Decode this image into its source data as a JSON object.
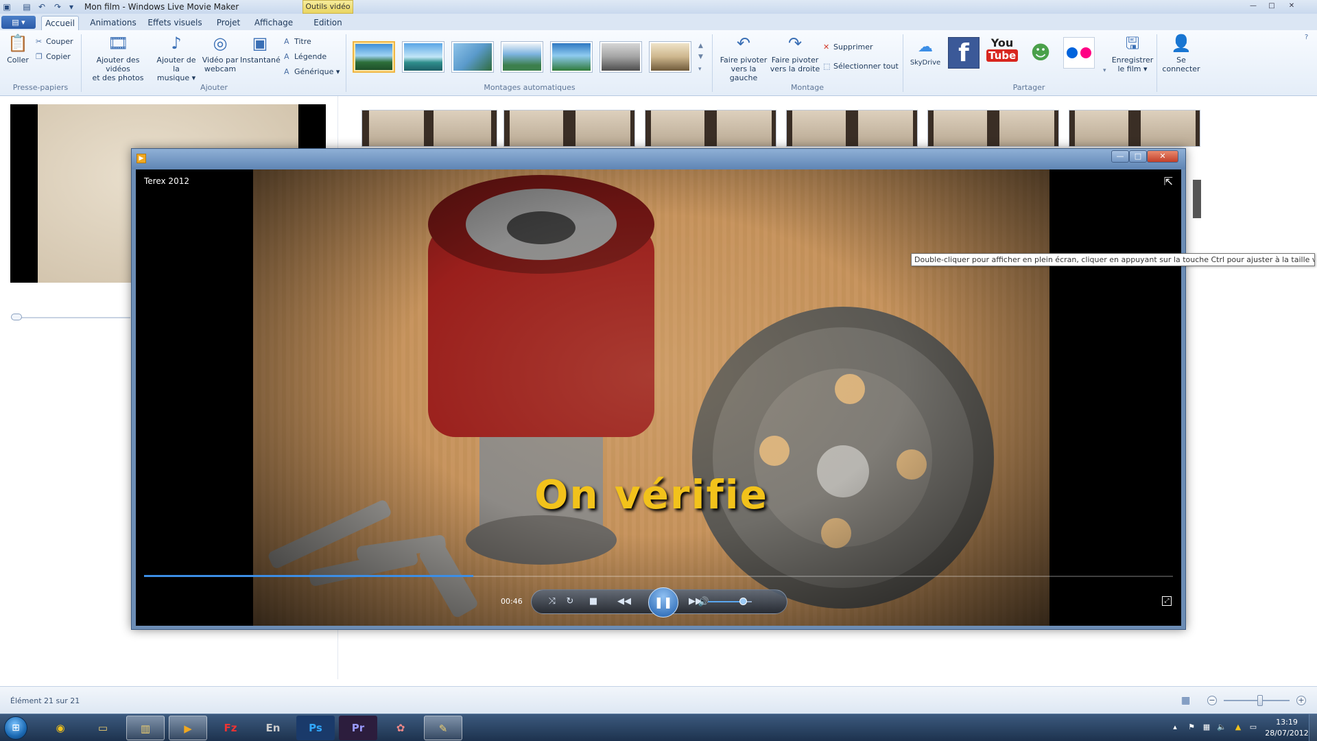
{
  "window": {
    "title": "Mon film - Windows Live Movie Maker",
    "contextual_tab": "Outils vidéo",
    "controls": {
      "minimize": "—",
      "maximize": "□",
      "close": "✕"
    }
  },
  "ribbon": {
    "file_button": "▤ ▾",
    "tabs": [
      {
        "label": "Accueil",
        "active": true
      },
      {
        "label": "Animations"
      },
      {
        "label": "Effets visuels"
      },
      {
        "label": "Projet"
      },
      {
        "label": "Affichage"
      },
      {
        "label": "Edition"
      }
    ],
    "groups": {
      "clipboard": {
        "label": "Presse-papiers",
        "paste": "Coller",
        "cut": "Couper",
        "copy": "Copier"
      },
      "add": {
        "label": "Ajouter",
        "add_videos_line1": "Ajouter des vidéos",
        "add_videos_line2": "et des photos",
        "add_music_line1": "Ajouter de la",
        "add_music_line2": "musique ▾",
        "webcam_line1": "Vidéo par",
        "webcam_line2": "webcam",
        "snapshot": "Instantané",
        "title": "Titre",
        "caption": "Légende",
        "credits": "Générique ▾"
      },
      "auto_movie": {
        "label": "Montages automatiques"
      },
      "editing": {
        "label": "Montage",
        "rotate_left_line1": "Faire pivoter",
        "rotate_left_line2": "vers la gauche",
        "rotate_right_line1": "Faire pivoter",
        "rotate_right_line2": "vers la droite",
        "delete": "Supprimer",
        "select_all": "Sélectionner tout"
      },
      "share": {
        "label": "Partager",
        "skydrive": "SkyDrive",
        "facebook": "f",
        "youtube_line1": "You",
        "youtube_line2": "Tube",
        "save_movie_line1": "Enregistrer",
        "save_movie_line2": "le film ▾",
        "sign_in_line1": "Se",
        "sign_in_line2": "connecter"
      }
    }
  },
  "video_window": {
    "video_title": "Terex 2012",
    "caption_overlay": "On vérifie",
    "time": "00:46",
    "progress": 0.32,
    "volume": 0.8,
    "controls": {
      "minimize": "—",
      "maximize": "□",
      "close": "✕"
    }
  },
  "tooltip": "Double-cliquer pour afficher en plein écran, cliquer en appuyant sur la touche Ctrl pour ajuster à la taille vidéo",
  "statusbar": {
    "item_text": "Élément 21 sur 21",
    "zoom_level": 0.55,
    "zoom_out": "−",
    "zoom_in": "+"
  },
  "taskbar": {
    "apps": [
      {
        "name": "chrome",
        "label": "◉"
      },
      {
        "name": "explorer",
        "label": "▭"
      },
      {
        "name": "libraries",
        "label": "▥"
      },
      {
        "name": "media-player",
        "label": "▶",
        "active": true
      },
      {
        "name": "filezilla",
        "label": "Fz"
      },
      {
        "name": "language",
        "label": "En"
      },
      {
        "name": "photoshop",
        "label": "Ps"
      },
      {
        "name": "premiere",
        "label": "Pr"
      },
      {
        "name": "paint",
        "label": "✿"
      },
      {
        "name": "movie-maker",
        "label": "✎",
        "active": true
      }
    ],
    "clock_time": "13:19",
    "clock_date": "28/07/2012"
  },
  "colors": {
    "accent": "#3c8ee6",
    "caption_yellow": "#f2c21b",
    "ribbon_bg": "#e4edf8",
    "taskbar": "#1d324e"
  }
}
